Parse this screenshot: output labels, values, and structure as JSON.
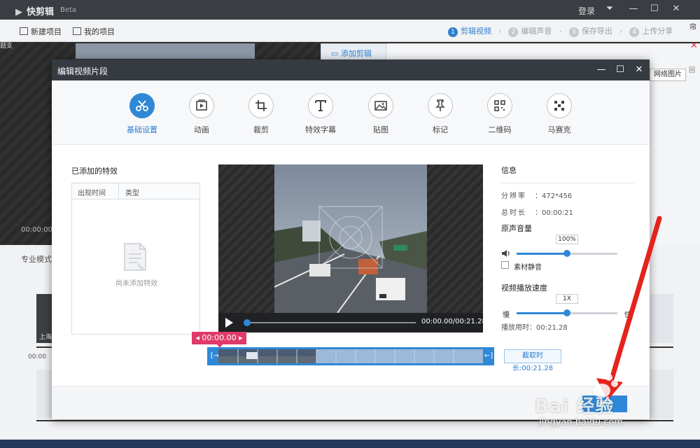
{
  "app": {
    "name": "快剪辑",
    "badge": "Beta",
    "login": "登录"
  },
  "toolbar": {
    "new_project": "新建项目",
    "my_projects": "我的项目",
    "steps": [
      {
        "num": "1",
        "label": "剪辑视频",
        "active": true
      },
      {
        "num": "2",
        "label": "编辑声音",
        "active": false
      },
      {
        "num": "3",
        "label": "保存导出",
        "active": false
      },
      {
        "num": "4",
        "label": "上传分享",
        "active": false
      }
    ]
  },
  "background": {
    "add_clip_tab": "添加剪辑",
    "time": "00:00:00",
    "mode": "专业模式",
    "clip_label": "上海",
    "ruler_time": "00:00",
    "web_image": "网络图片"
  },
  "dialog": {
    "title": "编辑视频片段",
    "tools": [
      {
        "label": "基础设置",
        "icon": "scissors-icon",
        "active": true
      },
      {
        "label": "动画",
        "icon": "animation-icon",
        "active": false
      },
      {
        "label": "裁剪",
        "icon": "crop-icon",
        "active": false
      },
      {
        "label": "特效字幕",
        "icon": "text-icon",
        "active": false
      },
      {
        "label": "贴图",
        "icon": "image-icon",
        "active": false
      },
      {
        "label": "标记",
        "icon": "pin-icon",
        "active": false
      },
      {
        "label": "二维码",
        "icon": "qrcode-icon",
        "active": false
      },
      {
        "label": "马赛克",
        "icon": "mosaic-icon",
        "active": false
      }
    ],
    "effects": {
      "title": "已添加的特效",
      "col_time": "出现时间",
      "col_type": "类型",
      "empty": "尚未添加特效"
    },
    "player": {
      "time": "00:00.00/00:21.28",
      "progress": 0
    },
    "trim": {
      "start_label": "00:00.00",
      "cut_duration": "截取时长:00:21.28"
    },
    "info": {
      "title": "信息",
      "resolution_label": "分辨率",
      "resolution": "472*456",
      "duration_label": "总时长",
      "duration": "00:00:21"
    },
    "volume": {
      "label": "原声音量",
      "value": "100%",
      "level": 0.5,
      "mute_label": "素材静音"
    },
    "speed": {
      "label": "视频播放速度",
      "value": "1X",
      "slow": "慢",
      "fast": "快",
      "level": 0.5,
      "play_duration": "播放用时：00:21.28"
    },
    "confirm": "确定"
  },
  "watermark": {
    "text": "Bai 经验",
    "url": "jingyan.baidu.com"
  },
  "colors": {
    "accent": "#2f88d6",
    "trim_marker": "#e0396a",
    "annotation": "#e4231d",
    "titlebar": "#3a3d42"
  }
}
